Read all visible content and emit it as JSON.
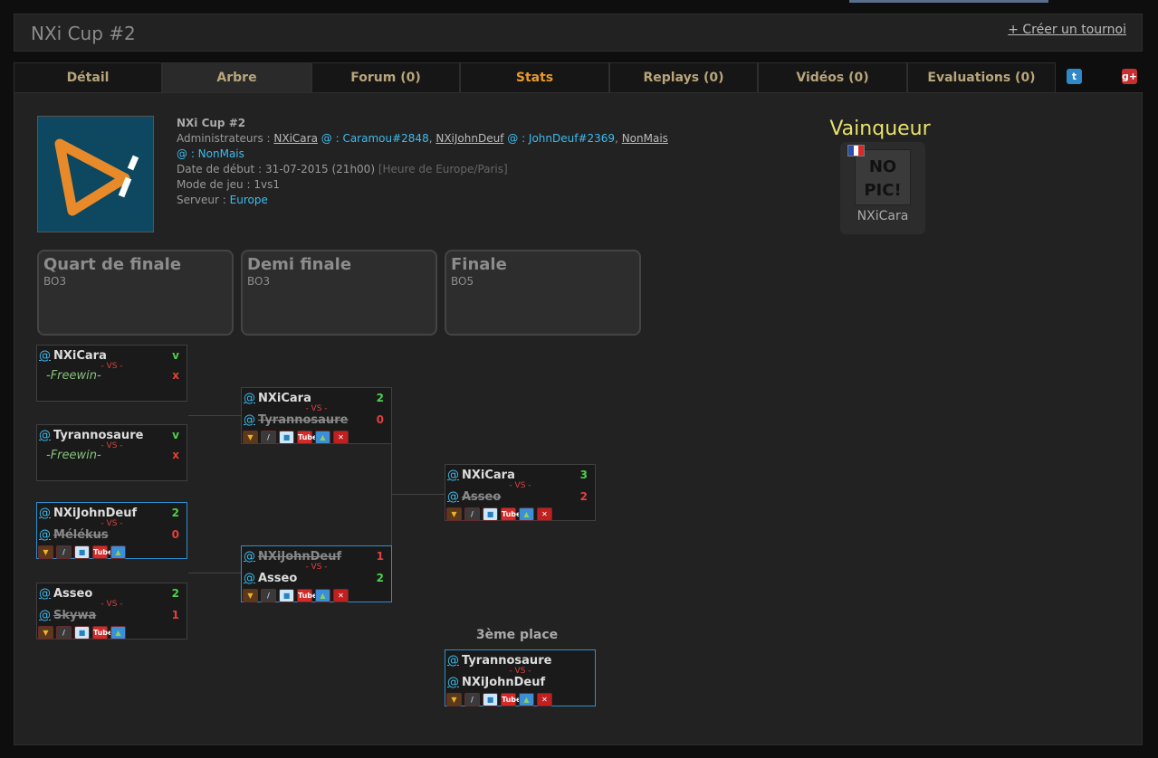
{
  "header": {
    "title": "NXi Cup #2",
    "create_link": "+ Créer un tournoi"
  },
  "tabs": [
    {
      "label": "Détail"
    },
    {
      "label": "Arbre"
    },
    {
      "label": "Forum (0)"
    },
    {
      "label": "Stats"
    },
    {
      "label": "Replays (0)"
    },
    {
      "label": "Vidéos (0)"
    },
    {
      "label": "Evaluations (0)"
    }
  ],
  "social": {
    "twitter": "twitter-icon",
    "gplus": "google-plus-icon"
  },
  "info": {
    "title": "NXi Cup #2",
    "admins_label": "Administrateurs :",
    "admin1": "NXiCara",
    "admin1_bnet": "@ : Caramou#2848",
    "admin2": "NXiJohnDeuf",
    "admin2_bnet": "@ : JohnDeuf#2369",
    "admin3": "NonMais",
    "admin3_bnet": "@ : NonMais",
    "date_label": "Date de début :",
    "date_value": "31-07-2015 (21h00)",
    "timezone": "[Heure de Europe/Paris]",
    "mode_label": "Mode de jeu :",
    "mode_value": "1vs1",
    "server_label": "Serveur :",
    "server_value": "Europe"
  },
  "winner": {
    "label": "Vainqueur",
    "name": "NXiCara",
    "nopic_line1": "NO",
    "nopic_line2": "PIC!",
    "flag_colors": [
      "#2b4fa8",
      "#ffffff",
      "#d82a2a"
    ]
  },
  "rounds": [
    {
      "name": "Quart de finale",
      "format": "BO3"
    },
    {
      "name": "Demi finale",
      "format": "BO3"
    },
    {
      "name": "Finale",
      "format": "BO5"
    }
  ],
  "matches": {
    "qf1": {
      "p1": "NXiCara",
      "s1": "v",
      "p2": "-Freewin-",
      "s2": "x",
      "vs": "- VS -"
    },
    "qf2": {
      "p1": "Tyrannosaure",
      "s1": "v",
      "p2": "-Freewin-",
      "s2": "x",
      "vs": "- VS -"
    },
    "qf3": {
      "p1": "NXiJohnDeuf",
      "s1": "2",
      "p2": "Mélékus",
      "s2": "0",
      "vs": "- VS -"
    },
    "qf4": {
      "p1": "Asseo",
      "s1": "2",
      "p2": "Skywa",
      "s2": "1",
      "vs": "- VS -"
    },
    "sf1": {
      "p1": "NXiCara",
      "s1": "2",
      "p2": "Tyrannosaure",
      "s2": "0",
      "vs": "- VS -"
    },
    "sf2": {
      "p1": "NXiJohnDeuf",
      "s1": "1",
      "p2": "Asseo",
      "s2": "2",
      "vs": "- VS -"
    },
    "final": {
      "p1": "NXiCara",
      "s1": "3",
      "p2": "Asseo",
      "s2": "2",
      "vs": "- VS -"
    },
    "third": {
      "label": "3ème place",
      "p1": "Tyrannosaure",
      "p2": "NXiJohnDeuf",
      "vs": "- VS -"
    }
  },
  "at_symbol": "@",
  "icon_labels": {
    "yt": "Tube"
  },
  "colors": {
    "accent_blue": "#3cbcee",
    "win": "#4bd24b",
    "lose": "#e04040",
    "winner_title": "#e8e06a"
  }
}
